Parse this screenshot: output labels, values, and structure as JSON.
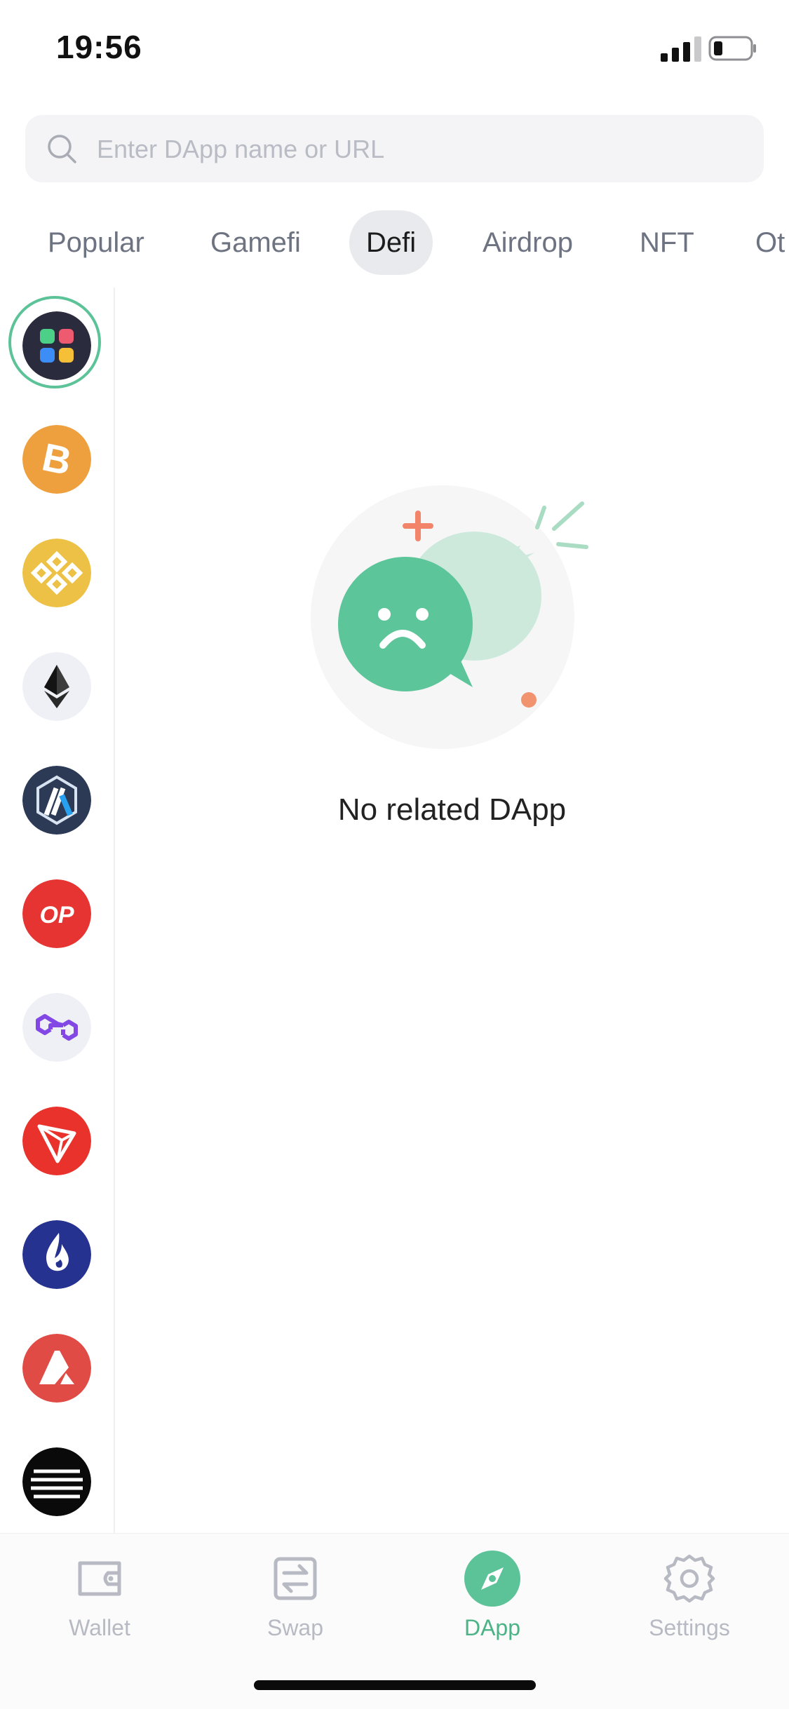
{
  "status_bar": {
    "time": "19:56"
  },
  "search": {
    "placeholder": "Enter DApp name or URL"
  },
  "tabs": [
    {
      "label": "Popular"
    },
    {
      "label": "Gamefi"
    },
    {
      "label": "Defi",
      "active": true
    },
    {
      "label": "Airdrop"
    },
    {
      "label": "NFT"
    },
    {
      "label": "Ot"
    }
  ],
  "chains": [
    {
      "icon": "all-chains-icon",
      "selected": true
    },
    {
      "icon": "bitcoin-icon"
    },
    {
      "icon": "bnb-chain-icon"
    },
    {
      "icon": "ethereum-icon"
    },
    {
      "icon": "arbitrum-icon"
    },
    {
      "icon": "optimism-icon",
      "text": "OP"
    },
    {
      "icon": "polygon-icon"
    },
    {
      "icon": "tron-icon"
    },
    {
      "icon": "heco-icon"
    },
    {
      "icon": "avalanche-icon"
    },
    {
      "icon": "aptos-icon"
    }
  ],
  "empty_state": {
    "message": "No related DApp",
    "icon": "sad-chat-bubble-icon"
  },
  "bottom_nav": [
    {
      "label": "Wallet",
      "icon": "wallet-icon"
    },
    {
      "label": "Swap",
      "icon": "swap-icon"
    },
    {
      "label": "DApp",
      "icon": "compass-icon",
      "active": true
    },
    {
      "label": "Settings",
      "icon": "gear-icon"
    }
  ],
  "colors": {
    "accent": "#5cc398",
    "active_label": "#4bb386",
    "inactive_label": "#b7bac2",
    "tab_inactive": "#6e7381",
    "search_bg": "#f4f4f6"
  }
}
